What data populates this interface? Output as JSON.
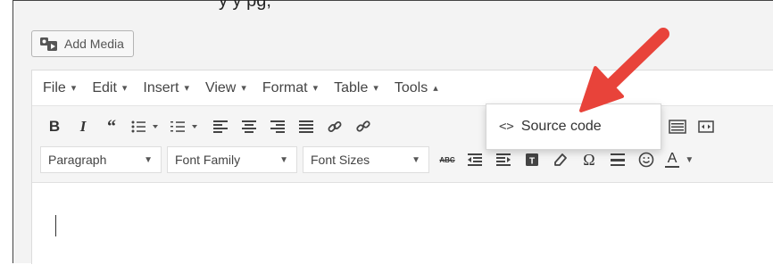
{
  "header_fragment": "y                                                y   pg,",
  "add_media_label": "Add Media",
  "menubar": {
    "items": [
      {
        "label": "File",
        "caret": "▾"
      },
      {
        "label": "Edit",
        "caret": "▾"
      },
      {
        "label": "Insert",
        "caret": "▾"
      },
      {
        "label": "View",
        "caret": "▾"
      },
      {
        "label": "Format",
        "caret": "▾"
      },
      {
        "label": "Table",
        "caret": "▾"
      },
      {
        "label": "Tools",
        "caret": "▴"
      }
    ]
  },
  "toolbar": {
    "row1_icons": [
      "bold-icon",
      "italic-icon",
      "blockquote-icon",
      "bullet-list-icon",
      "numbered-list-icon",
      "align-left-icon",
      "align-center-icon",
      "align-right-icon",
      "align-justify-icon",
      "link-icon",
      "unlink-icon",
      "keyboard-icon",
      "fullscreen-icon"
    ],
    "paragraph": "Paragraph",
    "font_family": "Font Family",
    "font_sizes": "Font Sizes",
    "row2_icons": [
      "strikethrough-icon",
      "outdent-icon",
      "indent-icon",
      "paste-text-icon",
      "clear-format-icon",
      "special-char-icon",
      "horizontal-rule-icon",
      "emoji-icon",
      "text-color-icon"
    ],
    "omega": "Ω",
    "text_color_label": "A",
    "abc_label": "ABC"
  },
  "dropdown": {
    "icon_text": "<>",
    "item_label": "Source code"
  },
  "colors": {
    "arrow": "#e8433a",
    "text": "#444444"
  }
}
